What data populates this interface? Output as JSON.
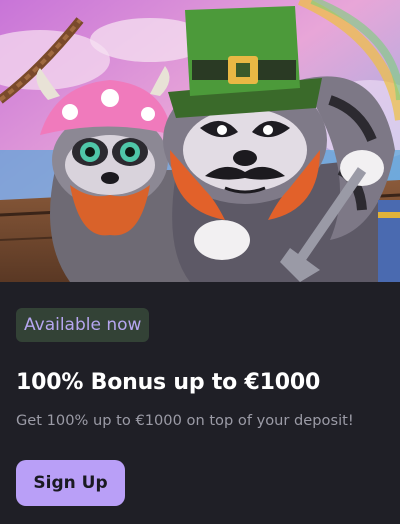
{
  "promo": {
    "badge": "Available now",
    "title": "100% Bonus up to €1000",
    "subtitle": "Get 100% up to €1000 on top of your deposit!",
    "cta_label": "Sign Up"
  },
  "colors": {
    "background": "#1f1f26",
    "badge_bg": "#334236",
    "badge_text": "#b6a6f0",
    "cta_bg": "#b99ff7",
    "title": "#ffffff",
    "subtitle": "#9b9ba6"
  }
}
